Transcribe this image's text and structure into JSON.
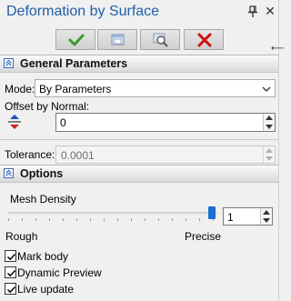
{
  "window": {
    "title": "Deformation by Surface",
    "pin_icon": "pin-icon",
    "close_icon": "close-icon"
  },
  "toolbar": {
    "buttons": [
      {
        "name": "ok",
        "icon": "checkmark-icon",
        "color": "#3a9a2a"
      },
      {
        "name": "preview",
        "icon": "preview-window-icon"
      },
      {
        "name": "zoom-preview",
        "icon": "magnify-window-icon"
      },
      {
        "name": "cancel",
        "icon": "red-x-icon",
        "color": "#d01010"
      }
    ]
  },
  "general": {
    "title": "General Parameters",
    "mode_label": "Mode:",
    "mode_value": "By Parameters",
    "offset_label": "Offset by Normal:",
    "offset_value": "0",
    "tolerance_label": "Tolerance:",
    "tolerance_value": "0.0001"
  },
  "options": {
    "title": "Options",
    "mesh_density_label": "Mesh Density",
    "mesh_density_value": "1",
    "slider_level": 0.975,
    "rough_label": "Rough",
    "precise_label": "Precise",
    "checkboxes": [
      {
        "label": "Mark body",
        "checked": true
      },
      {
        "label": "Dynamic Preview",
        "checked": true
      },
      {
        "label": "Live update",
        "checked": true
      }
    ]
  },
  "colors": {
    "title": "#1f5ea8",
    "slider_thumb": "#1a6fd1",
    "section_icon": "#3a6bb0"
  }
}
